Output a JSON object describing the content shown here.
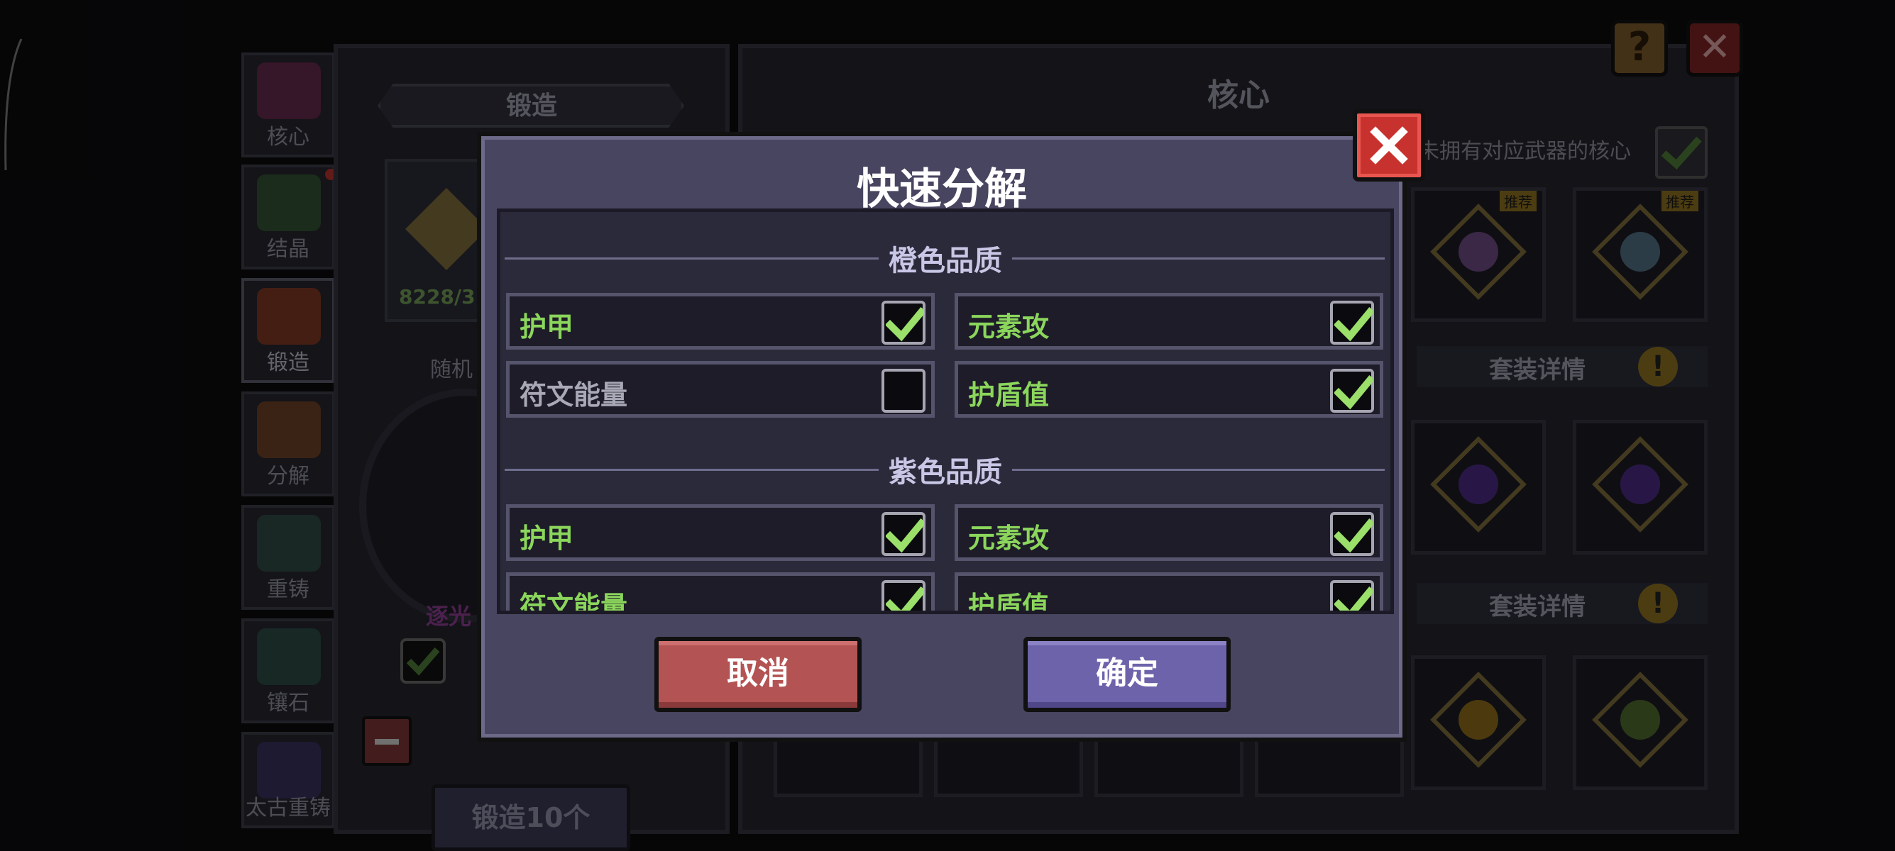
{
  "sidebar": {
    "items": [
      {
        "label": "核心",
        "color": "#a02a6a"
      },
      {
        "label": "结晶",
        "color": "#3f7a3a"
      },
      {
        "label": "锻造",
        "color": "#b5421e"
      },
      {
        "label": "分解",
        "color": "#b05a20"
      },
      {
        "label": "重铸",
        "color": "#3a6e5a"
      },
      {
        "label": "镶石",
        "color": "#2f6e5a"
      },
      {
        "label": "太古重铸",
        "color": "#4a3a8a"
      }
    ]
  },
  "forge_panel": {
    "title": "锻造",
    "count_text": "8228/3",
    "random_label": "随机",
    "light_label": "逐光",
    "forge10_button": "锻造10个"
  },
  "core_panel": {
    "title": "核心",
    "filter_text": "未拥有对应武器的核心",
    "badge": "推荐",
    "set_detail_label": "套装详情"
  },
  "top_buttons": {
    "help": "?",
    "close": "✕"
  },
  "dialog": {
    "title": "快速分解",
    "sections": [
      {
        "title": "橙色品质",
        "options": [
          {
            "label": "护甲",
            "checked": true
          },
          {
            "label": "元素攻",
            "checked": true
          },
          {
            "label": "符文能量",
            "checked": false
          },
          {
            "label": "护盾值",
            "checked": true
          }
        ]
      },
      {
        "title": "紫色品质",
        "options": [
          {
            "label": "护甲",
            "checked": true
          },
          {
            "label": "元素攻",
            "checked": true
          },
          {
            "label": "符文能量",
            "checked": true
          },
          {
            "label": "护盾值",
            "checked": true
          }
        ]
      }
    ],
    "cancel_label": "取消",
    "confirm_label": "确定"
  },
  "colors": {
    "checked_text": "#8bd65c",
    "unchecked_text": "#a9a8b6",
    "cancel_bg": "#b35353",
    "confirm_bg": "#6c63aa",
    "close_bg": "#c8322e"
  }
}
